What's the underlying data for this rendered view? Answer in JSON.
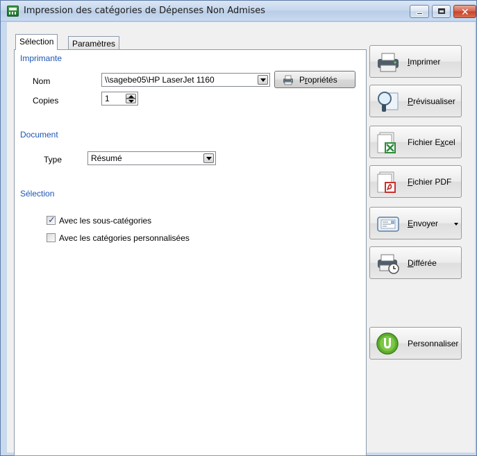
{
  "window": {
    "title": "Impression des catégories de Dépenses Non Admises"
  },
  "tabs": [
    {
      "label": "Sélection",
      "active": true
    },
    {
      "label": "Paramètres",
      "active": false
    }
  ],
  "printer": {
    "section_label": "Imprimante",
    "name_label": "Nom",
    "name_value": "\\\\sagebe05\\HP LaserJet 1160",
    "properties_label_underlined": "r",
    "properties_label_pre": "P",
    "properties_label_post": "opriétés",
    "copies_label": "Copies",
    "copies_value": "1"
  },
  "document": {
    "section_label": "Document",
    "type_label": "Type",
    "type_value": "Résumé"
  },
  "selection": {
    "section_label": "Sélection",
    "options": [
      {
        "label": "Avec les sous-catégories",
        "checked": true
      },
      {
        "label": "Avec les catégories personnalisées",
        "checked": false
      }
    ]
  },
  "actions": [
    {
      "id": "imprimer",
      "mnemonic": "I",
      "rest": "mprimer"
    },
    {
      "id": "previsualiser",
      "mnemonic": "P",
      "rest": "révisualiser"
    },
    {
      "id": "excel",
      "pre": "Fichier E",
      "mnemonic": "x",
      "rest": "cel"
    },
    {
      "id": "pdf",
      "mnemonic": "F",
      "rest": "ichier PDF"
    },
    {
      "id": "envoyer",
      "mnemonic": "E",
      "rest": "nvoyer",
      "dropdown": true
    },
    {
      "id": "differee",
      "mnemonic": "D",
      "rest": "ifférée"
    },
    {
      "id": "personnaliser",
      "label": "Personnaliser"
    }
  ]
}
